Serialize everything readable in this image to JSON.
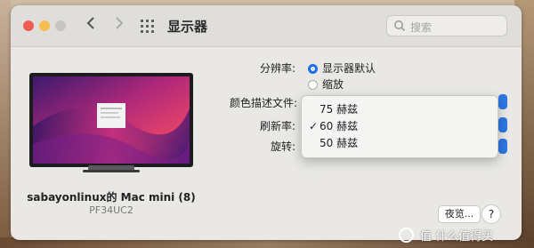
{
  "window": {
    "title": "显示器",
    "search_placeholder": "搜索"
  },
  "display": {
    "name": "sabayonlinux的 Mac mini (8)",
    "model": "PF34UC2"
  },
  "settings": {
    "resolution_label": "分辨率:",
    "resolution_options": [
      {
        "label": "显示器默认",
        "selected": true
      },
      {
        "label": "缩放",
        "selected": false
      }
    ],
    "color_profile_label": "颜色描述文件:",
    "refresh_rate_label": "刷新率:",
    "rotation_label": "旋转:"
  },
  "refresh_menu": {
    "items": [
      {
        "label": "75 赫兹",
        "checked": false
      },
      {
        "label": "60 赫兹",
        "checked": true
      },
      {
        "label": "50 赫兹",
        "checked": false
      }
    ],
    "check_glyph": "✓"
  },
  "buttons": {
    "night_shift": "夜览...",
    "help": "?"
  },
  "watermark": {
    "text": "值 什么值得买"
  },
  "colors": {
    "accent": "#1e6fe8",
    "close": "#ee5c55",
    "minimize": "#f5be4f"
  }
}
